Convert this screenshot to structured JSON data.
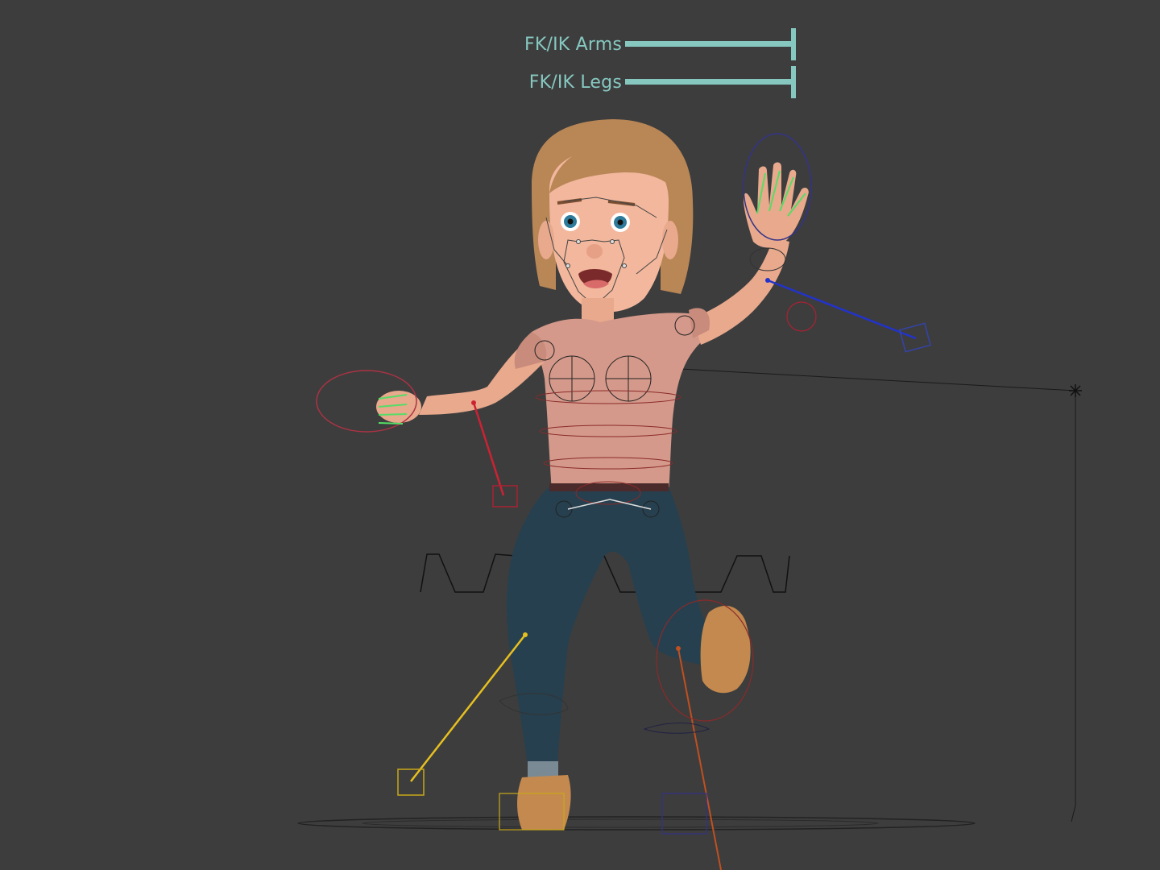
{
  "viewport": {
    "background": "#3d3d3d",
    "accent": "#86c8c0"
  },
  "sliders": [
    {
      "label": "FK/IK Arms",
      "value": 1.0
    },
    {
      "label": "FK/IK Legs",
      "value": 1.0
    }
  ],
  "rig_colors": {
    "left_arm": "#2233cc",
    "right_arm": "#cc2233",
    "left_leg": "#e6c020",
    "right_leg": "#c05020",
    "finger": "#55dd66"
  }
}
